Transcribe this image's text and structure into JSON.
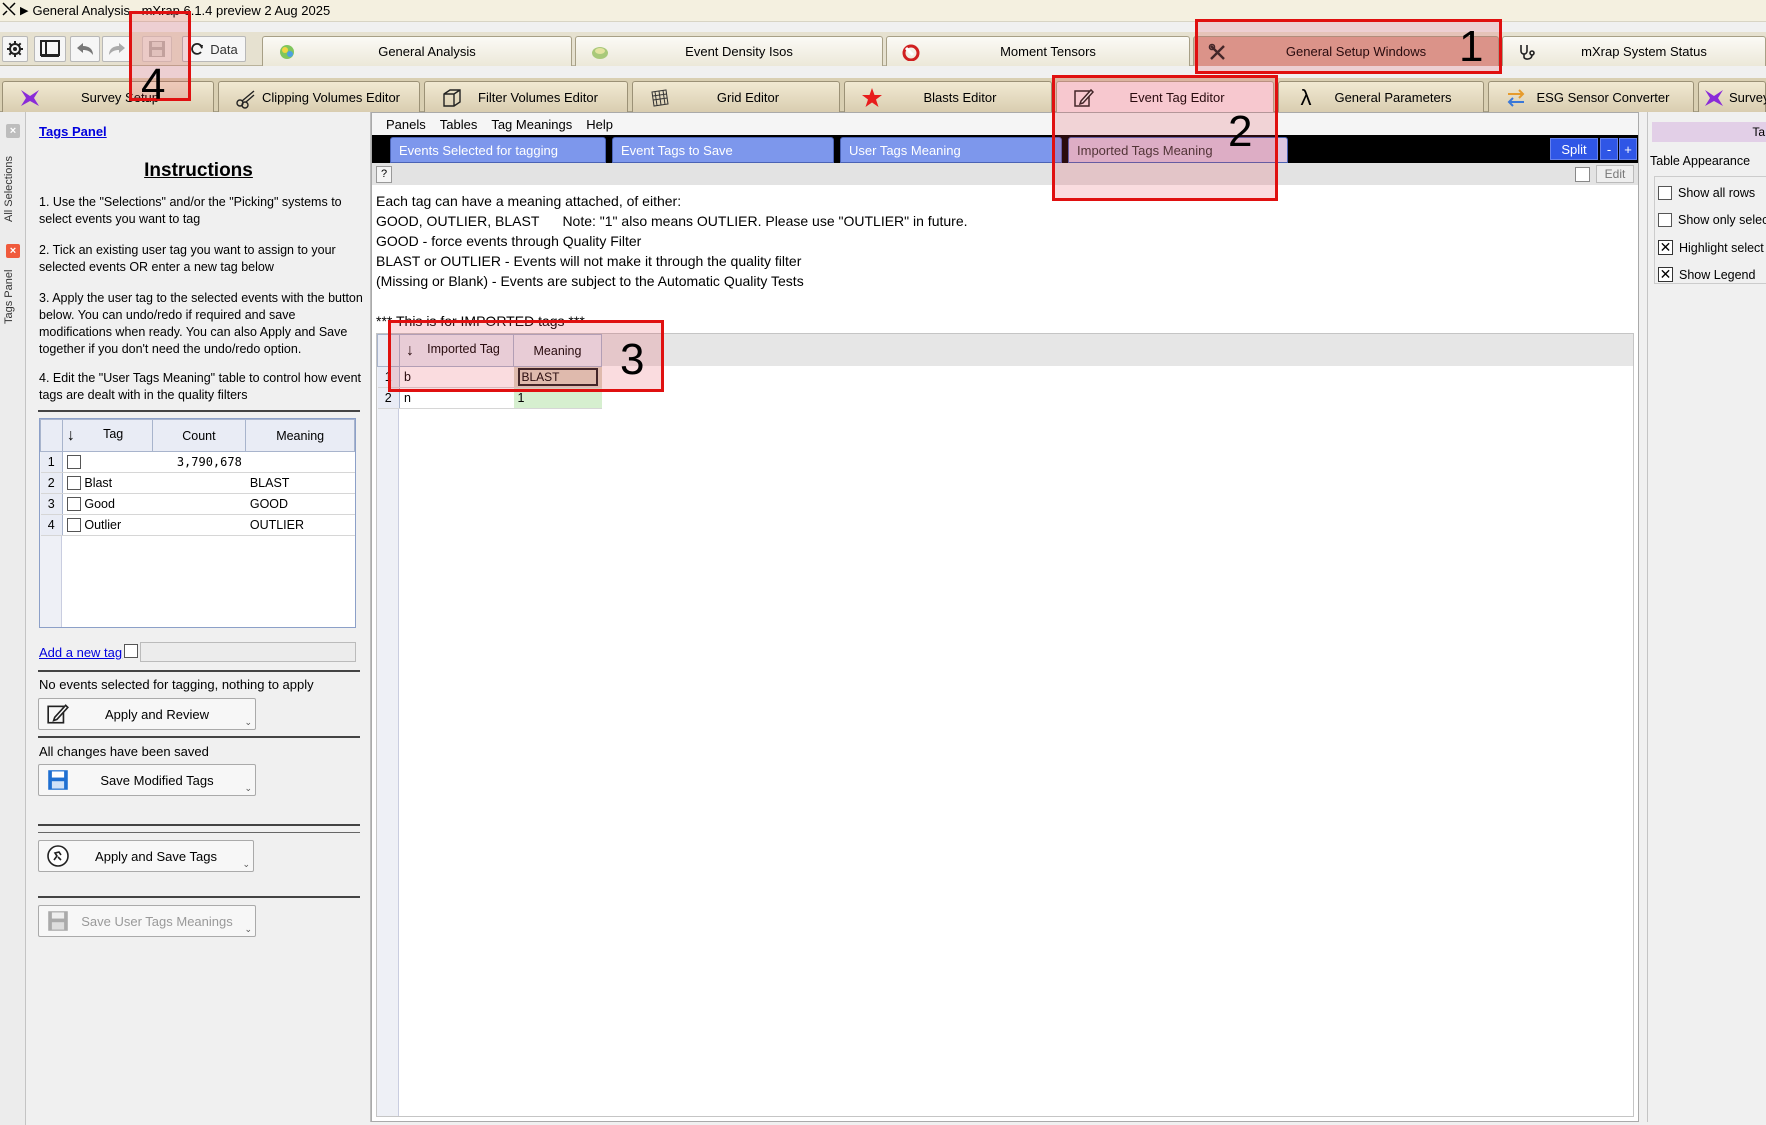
{
  "window": {
    "title": "General Analysis - mXrap 6.1.4 preview 2 Aug 2025"
  },
  "toolbar": {
    "data_label": "Data"
  },
  "main_tabs": [
    {
      "label": "General Analysis",
      "icon": "globe-icon"
    },
    {
      "label": "Event Density Isos",
      "icon": "iso-blob-icon"
    },
    {
      "label": "Moment Tensors",
      "icon": "beachball-icon"
    },
    {
      "label": "General Setup Windows",
      "icon": "tools-icon",
      "active": true
    },
    {
      "label": "mXrap System Status",
      "icon": "stethoscope-icon"
    }
  ],
  "sub_tabs": [
    {
      "label": "Survey Setup"
    },
    {
      "label": "Clipping Volumes Editor"
    },
    {
      "label": "Filter Volumes Editor"
    },
    {
      "label": "Grid Editor"
    },
    {
      "label": "Blasts Editor"
    },
    {
      "label": "Event Tag Editor",
      "active": true
    },
    {
      "label": "General Parameters"
    },
    {
      "label": "ESG Sensor Converter"
    },
    {
      "label": "Survey"
    }
  ],
  "side_strip": {
    "all_selections": "All Selections",
    "tags_panel": "Tags Panel"
  },
  "tags_panel": {
    "link": "Tags Panel",
    "heading": "Instructions",
    "instructions": [
      "1.  Use the \"Selections\" and/or the \"Picking\" systems to select events you want to tag",
      "2.  Tick an existing user tag you want to assign to your selected events OR enter a new tag below",
      "3.  Apply the user tag to the selected events with the button below. You can undo/redo if required and save modifications when ready. You can also Apply and Save together if you don't need the undo/redo option.",
      "4.  Edit the \"User Tags Meaning\" table to control how event tags are dealt with in the quality filters"
    ],
    "table": {
      "headers": {
        "tag": "Tag",
        "count": "Count",
        "meaning": "Meaning"
      },
      "rows": [
        {
          "n": "1",
          "tag": "",
          "count": "3,790,678",
          "meaning": ""
        },
        {
          "n": "2",
          "tag": "Blast",
          "count": "",
          "meaning": "BLAST"
        },
        {
          "n": "3",
          "tag": "Good",
          "count": "",
          "meaning": "GOOD"
        },
        {
          "n": "4",
          "tag": "Outlier",
          "count": "",
          "meaning": "OUTLIER"
        }
      ]
    },
    "add_tag_link": "Add a new tag",
    "status_apply": "No events selected for tagging, nothing to apply",
    "apply_review": "Apply and Review",
    "status_saved": "All changes have been saved",
    "save_modified": "Save Modified Tags",
    "apply_save": "Apply and Save Tags",
    "save_meanings": "Save User Tags Meanings"
  },
  "center": {
    "menu": [
      "Panels",
      "Tables",
      "Tag Meanings",
      "Help"
    ],
    "inner_tabs": [
      {
        "label": "Events Selected for tagging"
      },
      {
        "label": "Event Tags to Save"
      },
      {
        "label": "User Tags Meaning"
      },
      {
        "label": "Imported Tags Meaning",
        "active": true
      }
    ],
    "split": "Split",
    "minus": "-",
    "plus": "+",
    "help": "?",
    "edit": "Edit",
    "description": [
      "Each tag can have a meaning attached, of either:",
      "GOOD, OUTLIER, BLAST      Note: \"1\" also means OUTLIER. Please use \"OUTLIER\" in future.",
      "GOOD - force events through Quality Filter",
      "BLAST or OUTLIER - Events will not make it through the quality filter",
      "(Missing or Blank) - Events are subject to the Automatic Quality Tests",
      "",
      "*** This is for IMPORTED tags ***"
    ],
    "imported_table": {
      "headers": {
        "tag": "Imported Tag",
        "meaning": "Meaning"
      },
      "rows": [
        {
          "n": "1",
          "tag": "b",
          "meaning": "BLAST"
        },
        {
          "n": "2",
          "tag": "n",
          "meaning": "1"
        }
      ]
    }
  },
  "right_panel": {
    "header": "Ta",
    "caption": "Table Appearance",
    "options": [
      {
        "label": "Show all rows",
        "checked": false
      },
      {
        "label": "Show only selec",
        "checked": false
      },
      {
        "label": "Highlight select",
        "checked": true
      },
      {
        "label": "Show Legend",
        "checked": true
      }
    ]
  },
  "annotations": [
    "1",
    "2",
    "3",
    "4"
  ]
}
